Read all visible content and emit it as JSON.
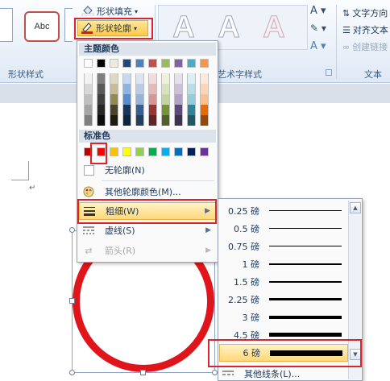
{
  "ribbon": {
    "shape_fill_label": "形状填充",
    "shape_outline_label": "形状轮廓",
    "shape_style_sample": "Abc",
    "group_shape_styles": "形状样式",
    "group_wordart_styles": "艺术字样式",
    "group_text": "文本",
    "text_direction_label": "文字方向",
    "align_text_label": "对齐文本",
    "create_link_label": "创建链接",
    "wordart_letter": "A"
  },
  "menu": {
    "theme_colors_label": "主题颜色",
    "standard_colors_label": "标准色",
    "no_outline_label": "无轮廓(N)",
    "more_colors_label": "其他轮廓颜色(M)...",
    "weight_label": "粗细(W)",
    "dashes_label": "虚线(S)",
    "arrows_label": "箭头(R)",
    "theme_top_row": [
      "#ffffff",
      "#000000",
      "#eeece1",
      "#1f497d",
      "#4f81bd",
      "#c0504d",
      "#9bbb59",
      "#8064a2",
      "#4bacc6",
      "#f79646"
    ],
    "theme_shades": [
      [
        "#f2f2f2",
        "#7f7f7f",
        "#ddd9c3",
        "#c6d9f0",
        "#dbe5f1",
        "#f2dcdb",
        "#ebf1dd",
        "#e5e0ec",
        "#dbeef3",
        "#fdeada"
      ],
      [
        "#d8d8d8",
        "#595959",
        "#c4bd97",
        "#8db3e2",
        "#b8cce4",
        "#e5b9b7",
        "#d7e3bc",
        "#ccc1d9",
        "#b7dde8",
        "#fbd5b5"
      ],
      [
        "#bfbfbf",
        "#3f3f3f",
        "#938953",
        "#548dd4",
        "#95b3d7",
        "#d99694",
        "#c3d69b",
        "#b2a2c7",
        "#92cddc",
        "#fac08f"
      ],
      [
        "#a5a5a5",
        "#262626",
        "#494429",
        "#17365d",
        "#366092",
        "#953734",
        "#76923c",
        "#5f497a",
        "#31859b",
        "#e36c09"
      ],
      [
        "#7f7f7f",
        "#0c0c0c",
        "#1d1b10",
        "#0f243e",
        "#244061",
        "#632423",
        "#4f6128",
        "#3f3151",
        "#205867",
        "#974806"
      ]
    ],
    "standard_colors": [
      "#c00000",
      "#ff0000",
      "#ffc000",
      "#ffff00",
      "#92d050",
      "#00b050",
      "#00b0f0",
      "#0070c0",
      "#002060",
      "#7030a0"
    ]
  },
  "weights": {
    "items": [
      {
        "label": "0.25 磅",
        "thickness": 1
      },
      {
        "label": "0.5 磅",
        "thickness": 1
      },
      {
        "label": "0.75 磅",
        "thickness": 1
      },
      {
        "label": "1 磅",
        "thickness": 2
      },
      {
        "label": "1.5 磅",
        "thickness": 2
      },
      {
        "label": "2.25 磅",
        "thickness": 3
      },
      {
        "label": "3 磅",
        "thickness": 4
      },
      {
        "label": "4.5 磅",
        "thickness": 5
      },
      {
        "label": "6 磅",
        "thickness": 7
      }
    ],
    "more_lines_label": "其他线条(L)...",
    "selected_index": 8
  },
  "document": {
    "paragraph_mark": "↵"
  },
  "colors": {
    "accent_red": "#d9262e",
    "circle_red": "#e0151b",
    "highlight": "#ffd87a"
  }
}
